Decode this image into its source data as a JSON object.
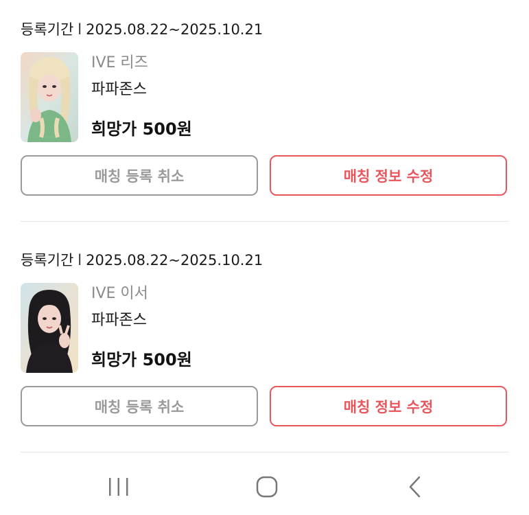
{
  "matches": [
    {
      "period_label": "등록기간",
      "period_separator": "l",
      "period_value": "2025.08.22~2025.10.21",
      "artist": "IVE 리즈",
      "seller": "파파존스",
      "price": "희망가 500원",
      "cancel_label": "매칭 등록 취소",
      "edit_label": "매칭 정보 수정",
      "photo_icon": "photocard-liz-image"
    },
    {
      "period_label": "등록기간",
      "period_separator": "l",
      "period_value": "2025.08.22~2025.10.21",
      "artist": "IVE 이서",
      "seller": "파파존스",
      "price": "희망가 500원",
      "cancel_label": "매칭 등록 취소",
      "edit_label": "매칭 정보 수정",
      "photo_icon": "photocard-leeseo-image"
    }
  ],
  "colors": {
    "accent": "#e8555b",
    "muted_border": "#9a9a9a",
    "muted_text": "#8a8a8a",
    "divider": "#e6e6e6"
  },
  "navbar": {
    "recents_icon": "recent-apps-icon",
    "home_icon": "home-icon",
    "back_icon": "back-icon"
  }
}
